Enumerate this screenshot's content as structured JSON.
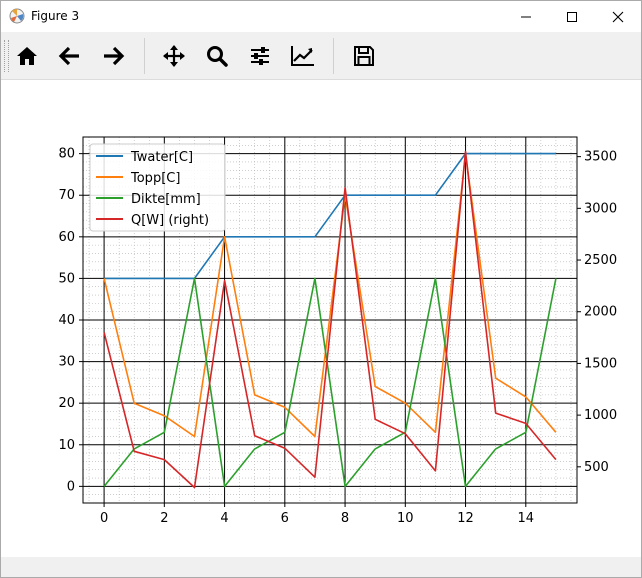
{
  "window": {
    "title": "Figure 3"
  },
  "toolbar": {
    "buttons": [
      {
        "name": "home",
        "icon": "home-icon"
      },
      {
        "name": "back",
        "icon": "arrow-left-icon"
      },
      {
        "name": "forward",
        "icon": "arrow-right-icon"
      },
      {
        "name": "pan",
        "icon": "move-icon"
      },
      {
        "name": "zoom",
        "icon": "zoom-icon"
      },
      {
        "name": "configure-subplots",
        "icon": "sliders-icon"
      },
      {
        "name": "edit-axis",
        "icon": "line-chart-icon"
      },
      {
        "name": "save",
        "icon": "floppy-disk-icon"
      }
    ]
  },
  "chart_data": {
    "type": "line",
    "x": [
      0,
      1,
      2,
      3,
      4,
      5,
      6,
      7,
      8,
      9,
      10,
      11,
      12,
      13,
      14,
      15
    ],
    "xlim": [
      -0.7,
      15.7
    ],
    "ylim": [
      -4,
      84
    ],
    "y2lim": [
      150,
      3690
    ],
    "xticks": [
      "0",
      "2",
      "4",
      "6",
      "8",
      "10",
      "12",
      "14"
    ],
    "yticks": [
      "0",
      "10",
      "20",
      "30",
      "40",
      "50",
      "60",
      "70",
      "80"
    ],
    "y2ticks": [
      "500",
      "1000",
      "1500",
      "2000",
      "2500",
      "3000",
      "3500"
    ],
    "grid": "major and minor",
    "legend_position": "top-left",
    "series": [
      {
        "name": "Twater[C]",
        "axis": "left",
        "color": "#1f77b4",
        "values": [
          50,
          50,
          50,
          50,
          60,
          60,
          60,
          60,
          70,
          70,
          70,
          70,
          80,
          80,
          80,
          80
        ]
      },
      {
        "name": "Topp[C]",
        "axis": "left",
        "color": "#ff7f0e",
        "values": [
          50,
          20,
          17,
          12,
          60,
          22,
          19,
          12,
          70,
          24,
          20,
          13,
          80,
          26,
          21.5,
          13
        ]
      },
      {
        "name": "Dikte[mm]",
        "axis": "left",
        "color": "#2ca02c",
        "values": [
          0,
          9,
          13,
          50,
          0,
          9,
          13,
          50,
          0,
          9,
          13,
          50,
          0,
          9,
          13,
          50
        ]
      },
      {
        "name": "Q[W] (right)",
        "axis": "right",
        "color": "#d62728",
        "values": [
          1800,
          650,
          570,
          300,
          2300,
          800,
          680,
          400,
          3200,
          960,
          820,
          460,
          3550,
          1020,
          920,
          570
        ]
      }
    ]
  }
}
